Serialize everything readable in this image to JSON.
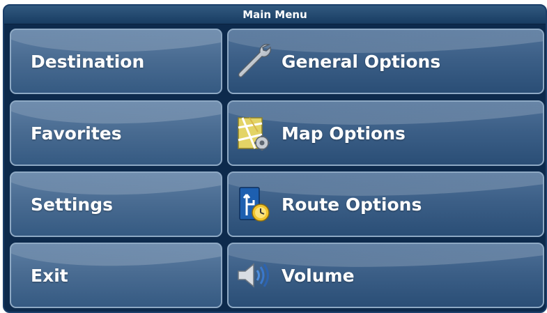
{
  "header": {
    "title": "Main Menu"
  },
  "left_buttons": [
    {
      "label": "Destination"
    },
    {
      "label": "Favorites"
    },
    {
      "label": "Settings"
    },
    {
      "label": "Exit"
    }
  ],
  "right_buttons": [
    {
      "label": "General Options",
      "icon": "wrench-icon"
    },
    {
      "label": "Map Options",
      "icon": "map-settings-icon"
    },
    {
      "label": "Route Options",
      "icon": "route-clock-icon"
    },
    {
      "label": "Volume",
      "icon": "speaker-icon"
    }
  ],
  "colors": {
    "background": "#0d2a4c",
    "button_border": "#8ea9c4",
    "text": "#ffffff"
  }
}
